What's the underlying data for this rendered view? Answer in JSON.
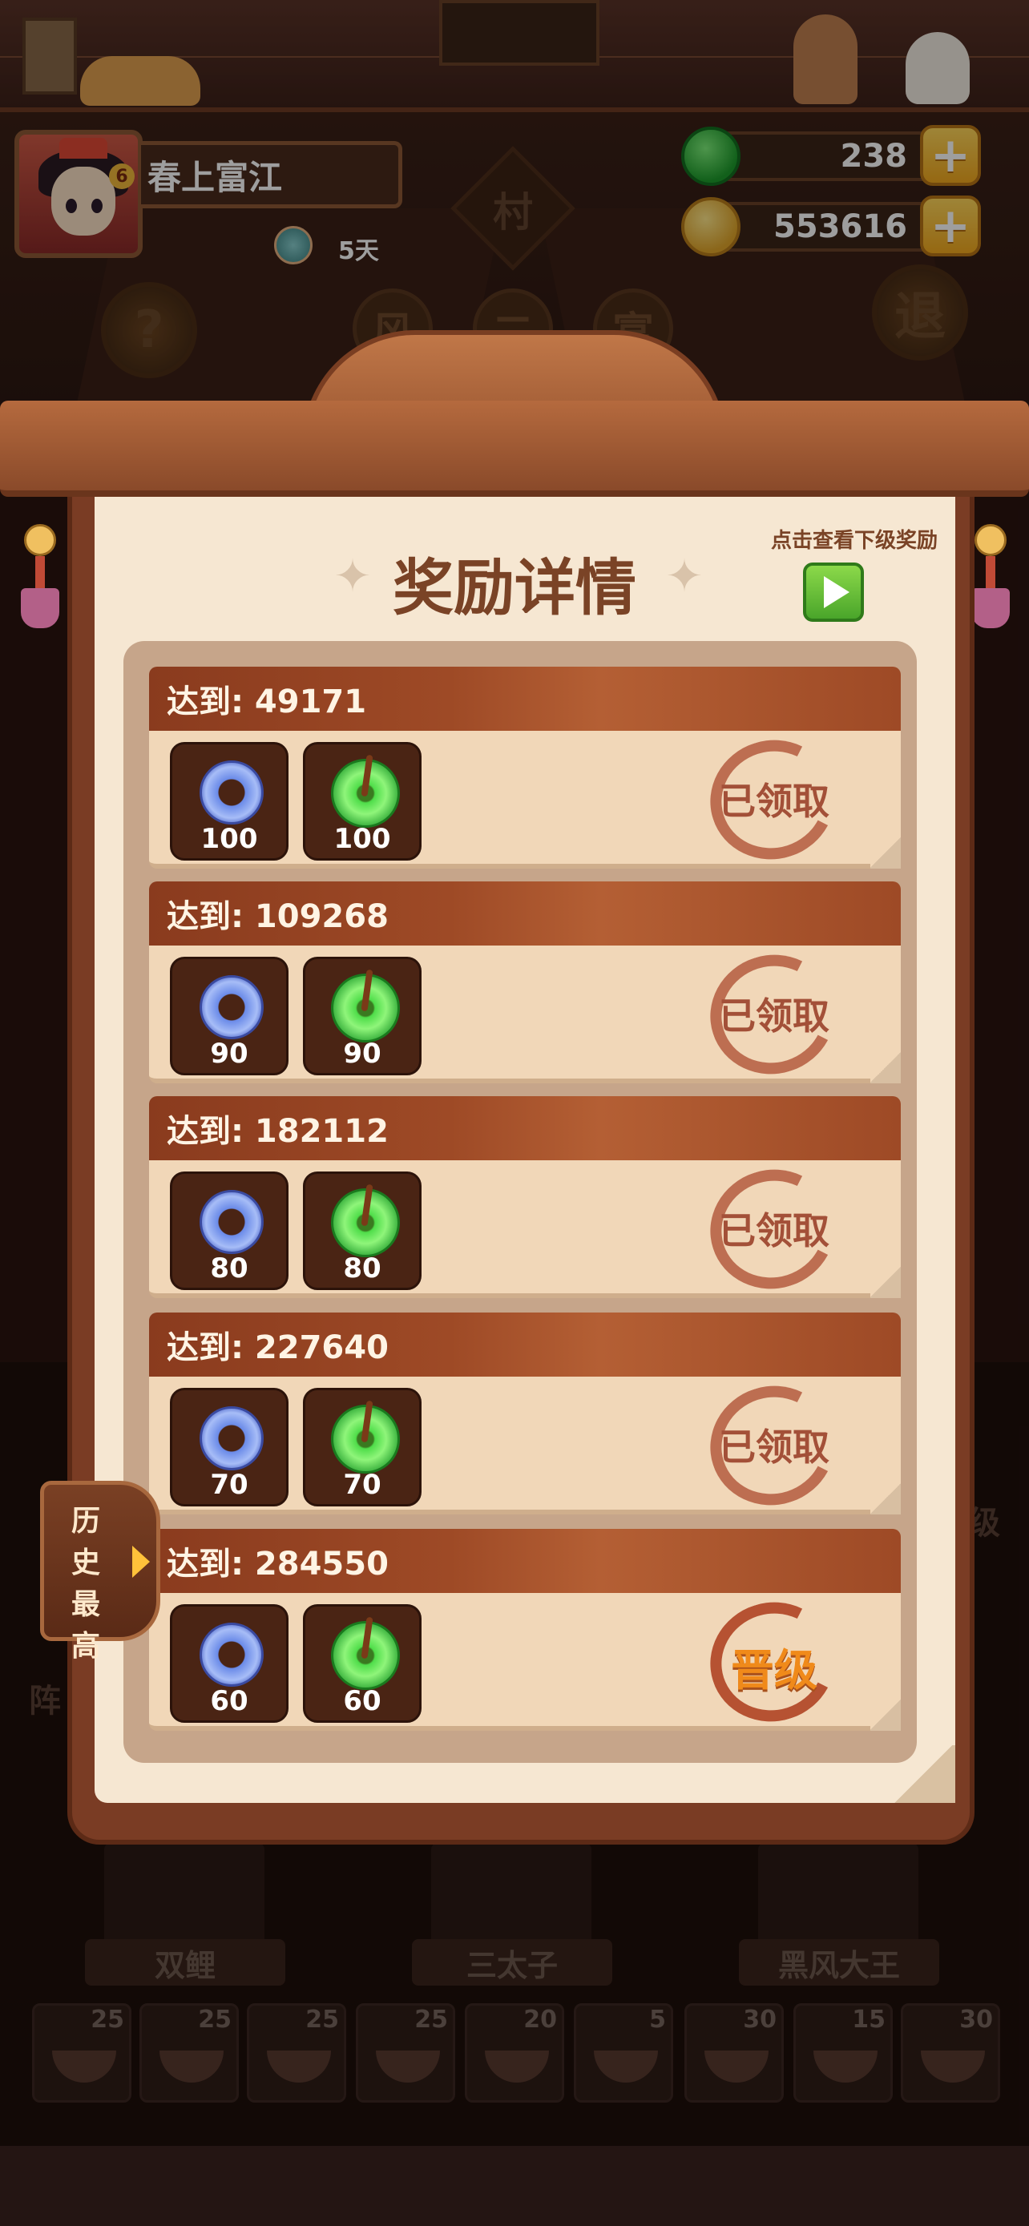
{
  "header": {
    "player_name": "春上富江",
    "days": "5天",
    "gems": "238",
    "coins": "553616",
    "plus_symbol": "+"
  },
  "scene": {
    "help_symbol": "?",
    "exit_label": "退",
    "sign_1": "风",
    "sign_2": "二",
    "sign_3": "富",
    "village_sign": "村",
    "side_label_right": "级",
    "side_label_left": "阵"
  },
  "modal": {
    "title": "奖励详情",
    "next_hint": "点击查看下级奖励",
    "history_tab": "历史最高"
  },
  "rewards": [
    {
      "label": "达到: 49171",
      "blue_qty": "100",
      "green_qty": "100",
      "status": "已领取"
    },
    {
      "label": "达到: 109268",
      "blue_qty": "90",
      "green_qty": "90",
      "status": "已领取"
    },
    {
      "label": "达到: 182112",
      "blue_qty": "80",
      "green_qty": "80",
      "status": "已领取"
    },
    {
      "label": "达到: 227640",
      "blue_qty": "70",
      "green_qty": "70",
      "status": "已领取"
    },
    {
      "label": "达到: 284550",
      "blue_qty": "60",
      "green_qty": "60",
      "status": "晋级"
    }
  ],
  "characters": [
    "双鲤",
    "三太子",
    "黑风大王"
  ],
  "dishes": [
    "25",
    "25",
    "25",
    "25",
    "20",
    "5",
    "30",
    "15",
    "30"
  ],
  "colors": {
    "accent_gold": "#f1a81e",
    "gem_green": "#2ca634",
    "header_brown": "#9e4a26",
    "paper": "#f6e7d2",
    "stamp_red": "#b45c40",
    "upgrade_orange": "#f08a1a"
  }
}
